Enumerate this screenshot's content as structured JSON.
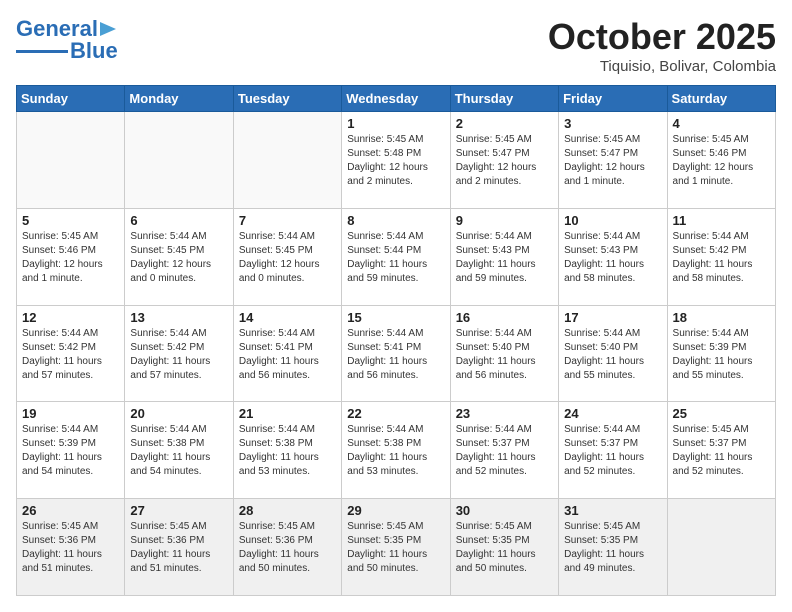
{
  "header": {
    "logo_general": "General",
    "logo_blue": "Blue",
    "month": "October 2025",
    "location": "Tiquisio, Bolivar, Colombia"
  },
  "weekdays": [
    "Sunday",
    "Monday",
    "Tuesday",
    "Wednesday",
    "Thursday",
    "Friday",
    "Saturday"
  ],
  "weeks": [
    [
      {
        "day": "",
        "info": ""
      },
      {
        "day": "",
        "info": ""
      },
      {
        "day": "",
        "info": ""
      },
      {
        "day": "1",
        "info": "Sunrise: 5:45 AM\nSunset: 5:48 PM\nDaylight: 12 hours\nand 2 minutes."
      },
      {
        "day": "2",
        "info": "Sunrise: 5:45 AM\nSunset: 5:47 PM\nDaylight: 12 hours\nand 2 minutes."
      },
      {
        "day": "3",
        "info": "Sunrise: 5:45 AM\nSunset: 5:47 PM\nDaylight: 12 hours\nand 1 minute."
      },
      {
        "day": "4",
        "info": "Sunrise: 5:45 AM\nSunset: 5:46 PM\nDaylight: 12 hours\nand 1 minute."
      }
    ],
    [
      {
        "day": "5",
        "info": "Sunrise: 5:45 AM\nSunset: 5:46 PM\nDaylight: 12 hours\nand 1 minute."
      },
      {
        "day": "6",
        "info": "Sunrise: 5:44 AM\nSunset: 5:45 PM\nDaylight: 12 hours\nand 0 minutes."
      },
      {
        "day": "7",
        "info": "Sunrise: 5:44 AM\nSunset: 5:45 PM\nDaylight: 12 hours\nand 0 minutes."
      },
      {
        "day": "8",
        "info": "Sunrise: 5:44 AM\nSunset: 5:44 PM\nDaylight: 11 hours\nand 59 minutes."
      },
      {
        "day": "9",
        "info": "Sunrise: 5:44 AM\nSunset: 5:43 PM\nDaylight: 11 hours\nand 59 minutes."
      },
      {
        "day": "10",
        "info": "Sunrise: 5:44 AM\nSunset: 5:43 PM\nDaylight: 11 hours\nand 58 minutes."
      },
      {
        "day": "11",
        "info": "Sunrise: 5:44 AM\nSunset: 5:42 PM\nDaylight: 11 hours\nand 58 minutes."
      }
    ],
    [
      {
        "day": "12",
        "info": "Sunrise: 5:44 AM\nSunset: 5:42 PM\nDaylight: 11 hours\nand 57 minutes."
      },
      {
        "day": "13",
        "info": "Sunrise: 5:44 AM\nSunset: 5:42 PM\nDaylight: 11 hours\nand 57 minutes."
      },
      {
        "day": "14",
        "info": "Sunrise: 5:44 AM\nSunset: 5:41 PM\nDaylight: 11 hours\nand 56 minutes."
      },
      {
        "day": "15",
        "info": "Sunrise: 5:44 AM\nSunset: 5:41 PM\nDaylight: 11 hours\nand 56 minutes."
      },
      {
        "day": "16",
        "info": "Sunrise: 5:44 AM\nSunset: 5:40 PM\nDaylight: 11 hours\nand 56 minutes."
      },
      {
        "day": "17",
        "info": "Sunrise: 5:44 AM\nSunset: 5:40 PM\nDaylight: 11 hours\nand 55 minutes."
      },
      {
        "day": "18",
        "info": "Sunrise: 5:44 AM\nSunset: 5:39 PM\nDaylight: 11 hours\nand 55 minutes."
      }
    ],
    [
      {
        "day": "19",
        "info": "Sunrise: 5:44 AM\nSunset: 5:39 PM\nDaylight: 11 hours\nand 54 minutes."
      },
      {
        "day": "20",
        "info": "Sunrise: 5:44 AM\nSunset: 5:38 PM\nDaylight: 11 hours\nand 54 minutes."
      },
      {
        "day": "21",
        "info": "Sunrise: 5:44 AM\nSunset: 5:38 PM\nDaylight: 11 hours\nand 53 minutes."
      },
      {
        "day": "22",
        "info": "Sunrise: 5:44 AM\nSunset: 5:38 PM\nDaylight: 11 hours\nand 53 minutes."
      },
      {
        "day": "23",
        "info": "Sunrise: 5:44 AM\nSunset: 5:37 PM\nDaylight: 11 hours\nand 52 minutes."
      },
      {
        "day": "24",
        "info": "Sunrise: 5:44 AM\nSunset: 5:37 PM\nDaylight: 11 hours\nand 52 minutes."
      },
      {
        "day": "25",
        "info": "Sunrise: 5:45 AM\nSunset: 5:37 PM\nDaylight: 11 hours\nand 52 minutes."
      }
    ],
    [
      {
        "day": "26",
        "info": "Sunrise: 5:45 AM\nSunset: 5:36 PM\nDaylight: 11 hours\nand 51 minutes."
      },
      {
        "day": "27",
        "info": "Sunrise: 5:45 AM\nSunset: 5:36 PM\nDaylight: 11 hours\nand 51 minutes."
      },
      {
        "day": "28",
        "info": "Sunrise: 5:45 AM\nSunset: 5:36 PM\nDaylight: 11 hours\nand 50 minutes."
      },
      {
        "day": "29",
        "info": "Sunrise: 5:45 AM\nSunset: 5:35 PM\nDaylight: 11 hours\nand 50 minutes."
      },
      {
        "day": "30",
        "info": "Sunrise: 5:45 AM\nSunset: 5:35 PM\nDaylight: 11 hours\nand 50 minutes."
      },
      {
        "day": "31",
        "info": "Sunrise: 5:45 AM\nSunset: 5:35 PM\nDaylight: 11 hours\nand 49 minutes."
      },
      {
        "day": "",
        "info": ""
      }
    ]
  ]
}
